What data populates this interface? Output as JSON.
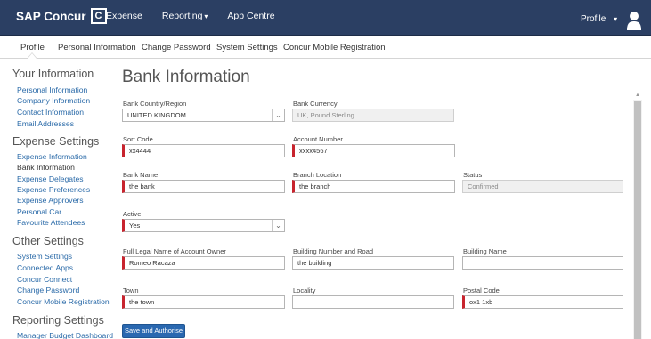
{
  "topbar": {
    "brand_text": "SAP Concur",
    "brand_mark": "C",
    "nav": [
      {
        "label": "Expense",
        "caret": ""
      },
      {
        "label": "Reporting",
        "caret": "▾"
      },
      {
        "label": "App Centre",
        "caret": ""
      }
    ],
    "profile_label": "Profile",
    "profile_caret": "▾"
  },
  "subtabs": [
    "Profile",
    "Personal Information",
    "Change Password",
    "System Settings",
    "Concur Mobile Registration"
  ],
  "sidebar": {
    "sections": [
      {
        "heading": "Your Information",
        "links": [
          "Personal Information",
          "Company Information",
          "Contact Information",
          "Email Addresses"
        ]
      },
      {
        "heading": "Expense Settings",
        "links": [
          "Expense Information",
          "Bank Information",
          "Expense Delegates",
          "Expense Preferences",
          "Expense Approvers",
          "Personal Car",
          "Favourite Attendees"
        ]
      },
      {
        "heading": "Other Settings",
        "links": [
          "System Settings",
          "Connected Apps",
          "Concur Connect",
          "Change Password",
          "Concur Mobile Registration"
        ]
      },
      {
        "heading": "Reporting Settings",
        "links": [
          "Manager Budget Dashboard"
        ]
      }
    ]
  },
  "main": {
    "title": "Bank Information",
    "fields": {
      "bank_country": {
        "label": "Bank Country/Region",
        "value": "UNITED KINGDOM",
        "arrow": "⌄"
      },
      "bank_currency": {
        "label": "Bank Currency",
        "value": "UK, Pound Sterling"
      },
      "sort_code": {
        "label": "Sort Code",
        "value": "xx4444"
      },
      "account_number": {
        "label": "Account Number",
        "value": "xxxx4567"
      },
      "bank_name": {
        "label": "Bank Name",
        "value": "the bank"
      },
      "branch_location": {
        "label": "Branch Location",
        "value": "the branch"
      },
      "status": {
        "label": "Status",
        "value": "Confirmed"
      },
      "active": {
        "label": "Active",
        "value": "Yes",
        "arrow": "⌄"
      },
      "full_legal_name": {
        "label": "Full Legal Name of Account Owner",
        "value": "Romeo Racaza"
      },
      "building_number_road": {
        "label": "Building Number and Road",
        "value": "the building"
      },
      "building_name": {
        "label": "Building Name",
        "value": ""
      },
      "town": {
        "label": "Town",
        "value": "the town"
      },
      "locality": {
        "label": "Locality",
        "value": ""
      },
      "postal_code": {
        "label": "Postal Code",
        "value": "ox1 1xb"
      }
    },
    "save_label": "Save and Authorise"
  },
  "colors": {
    "topbar": "#2b3f63",
    "link": "#2a6aa8",
    "required": "#c8242e",
    "button": "#2a68b0"
  }
}
